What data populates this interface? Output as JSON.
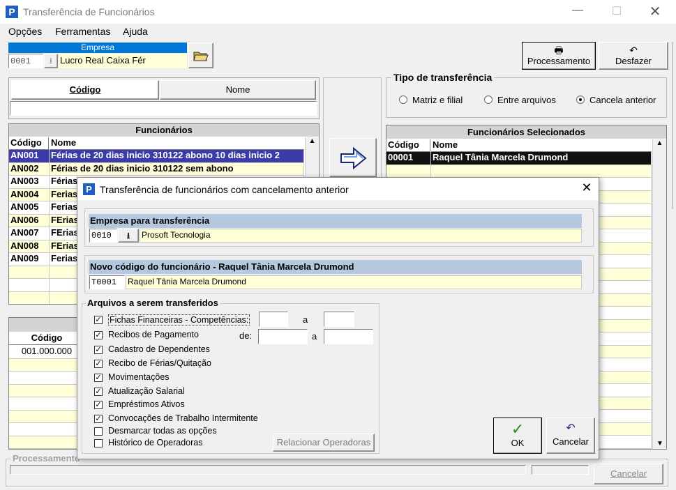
{
  "window": {
    "title": "Transferência de Funcionários"
  },
  "menu": [
    "Opções",
    "Ferramentas",
    "Ajuda"
  ],
  "empresa": {
    "header": "Empresa",
    "code": "0001",
    "name": "Lucro Real Caixa Fér"
  },
  "toolbar": {
    "processamento": "Processamento",
    "desfazer": "Desfazer"
  },
  "tabs": {
    "codigo": "Código",
    "nome": "Nome"
  },
  "tipo": {
    "title": "Tipo de transferência",
    "options": [
      "Matriz e filial",
      "Entre arquivos",
      "Cancela anterior"
    ],
    "selected": "Cancela anterior"
  },
  "funcionarios": {
    "title": "Funcionários",
    "col_codigo": "Código",
    "col_nome": "Nome",
    "rows": [
      {
        "code": "AN001",
        "name": "Férias de 20 dias inicio 310122 abono 10 dias inicio 2"
      },
      {
        "code": "AN002",
        "name": "Férias de 20 dias inicio 310122 sem abono"
      },
      {
        "code": "AN003",
        "name": "Férias"
      },
      {
        "code": "AN004",
        "name": "Ferias"
      },
      {
        "code": "AN005",
        "name": "Ferias"
      },
      {
        "code": "AN006",
        "name": "FErias"
      },
      {
        "code": "AN007",
        "name": "FErias"
      },
      {
        "code": "AN008",
        "name": "FErias"
      },
      {
        "code": "AN009",
        "name": "Ferias"
      }
    ]
  },
  "lower_table": {
    "col_codigo": "Código",
    "rows": [
      "001.000.000"
    ]
  },
  "selecionados": {
    "title": "Funcionários Selecionados",
    "col_codigo": "Código",
    "col_nome": "Nome",
    "rows": [
      {
        "code": "00001",
        "name": "Raquel Tânia Marcela Drumond"
      }
    ]
  },
  "status": {
    "processamento": "Processamento",
    "cancelar": "Cancelar"
  },
  "dialog": {
    "title": "Transferência de funcionários com cancelamento anterior",
    "empresa_section": "Empresa para transferência",
    "empresa_code": "0010",
    "empresa_name": "Prosoft Tecnologia",
    "novo_section": "Novo código do funcionário - Raquel Tânia Marcela Drumond",
    "novo_code": "T0001",
    "novo_name": "Raquel Tânia Marcela Drumond",
    "arquivos_title": "Arquivos a serem transferidos",
    "de_label": "de:",
    "a_label": "a",
    "checks": [
      {
        "label": "Fichas Financeiras - Competências:",
        "checked": true
      },
      {
        "label": "Recibos de Pagamento",
        "checked": true
      },
      {
        "label": "Cadastro de Dependentes",
        "checked": true
      },
      {
        "label": "Recibo de Férias/Quitação",
        "checked": true
      },
      {
        "label": "Movimentações",
        "checked": true
      },
      {
        "label": "Atualização Salarial",
        "checked": true
      },
      {
        "label": "Empréstimos Ativos",
        "checked": true
      },
      {
        "label": "Convocações de Trabalho Intermitente",
        "checked": true
      },
      {
        "label": "Desmarcar todas as opções",
        "checked": false
      },
      {
        "label": "Histórico de Operadoras",
        "checked": false
      }
    ],
    "relacionar": "Relacionar Operadoras",
    "ok": "OK",
    "cancelar": "Cancelar"
  },
  "colors": {
    "accent": "#0078d7",
    "selection": "#3c3ca8",
    "grid_yellow": "#ffffd8"
  }
}
